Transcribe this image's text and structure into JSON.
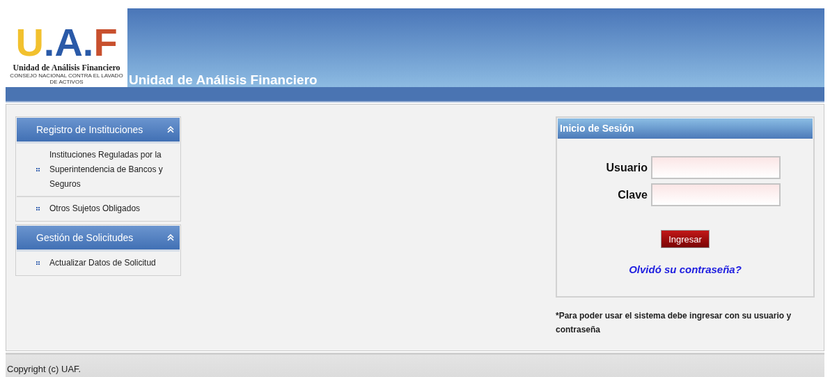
{
  "header": {
    "logo": {
      "letters": [
        {
          "text": "U",
          "color": "#f2c12e"
        },
        {
          "text": ".",
          "color": "#2a5aa8"
        },
        {
          "text": "A",
          "color": "#2a5aa8"
        },
        {
          "text": ".",
          "color": "#2a5aa8"
        },
        {
          "text": "F",
          "color": "#c8502e"
        }
      ],
      "name": "Unidad de Análisis Financiero",
      "tagline": "CONSEJO NACIONAL CONTRA EL LAVADO DE ACTIVOS"
    },
    "title": "Unidad de Análisis Financiero"
  },
  "sidebar": {
    "sections": [
      {
        "title": "Registro de Instituciones",
        "expanded": true,
        "items": [
          {
            "label": "Instituciones Reguladas por la Superintendencia de Bancos y Seguros"
          },
          {
            "label": "Otros Sujetos Obligados"
          }
        ]
      },
      {
        "title": "Gestión de Solicitudes",
        "expanded": true,
        "items": [
          {
            "label": "Actualizar Datos de Solicitud"
          }
        ]
      }
    ]
  },
  "login": {
    "title": "Inicio de Sesión",
    "fields": [
      {
        "label": "Usuario"
      },
      {
        "label": "Clave"
      }
    ],
    "submit": "Ingresar",
    "forgot": "Olvidó su contraseña?",
    "note": "*Para poder usar el sistema debe ingresar con su usuario y contraseña"
  },
  "footer": {
    "copyright": "Copyright (c) UAF."
  }
}
